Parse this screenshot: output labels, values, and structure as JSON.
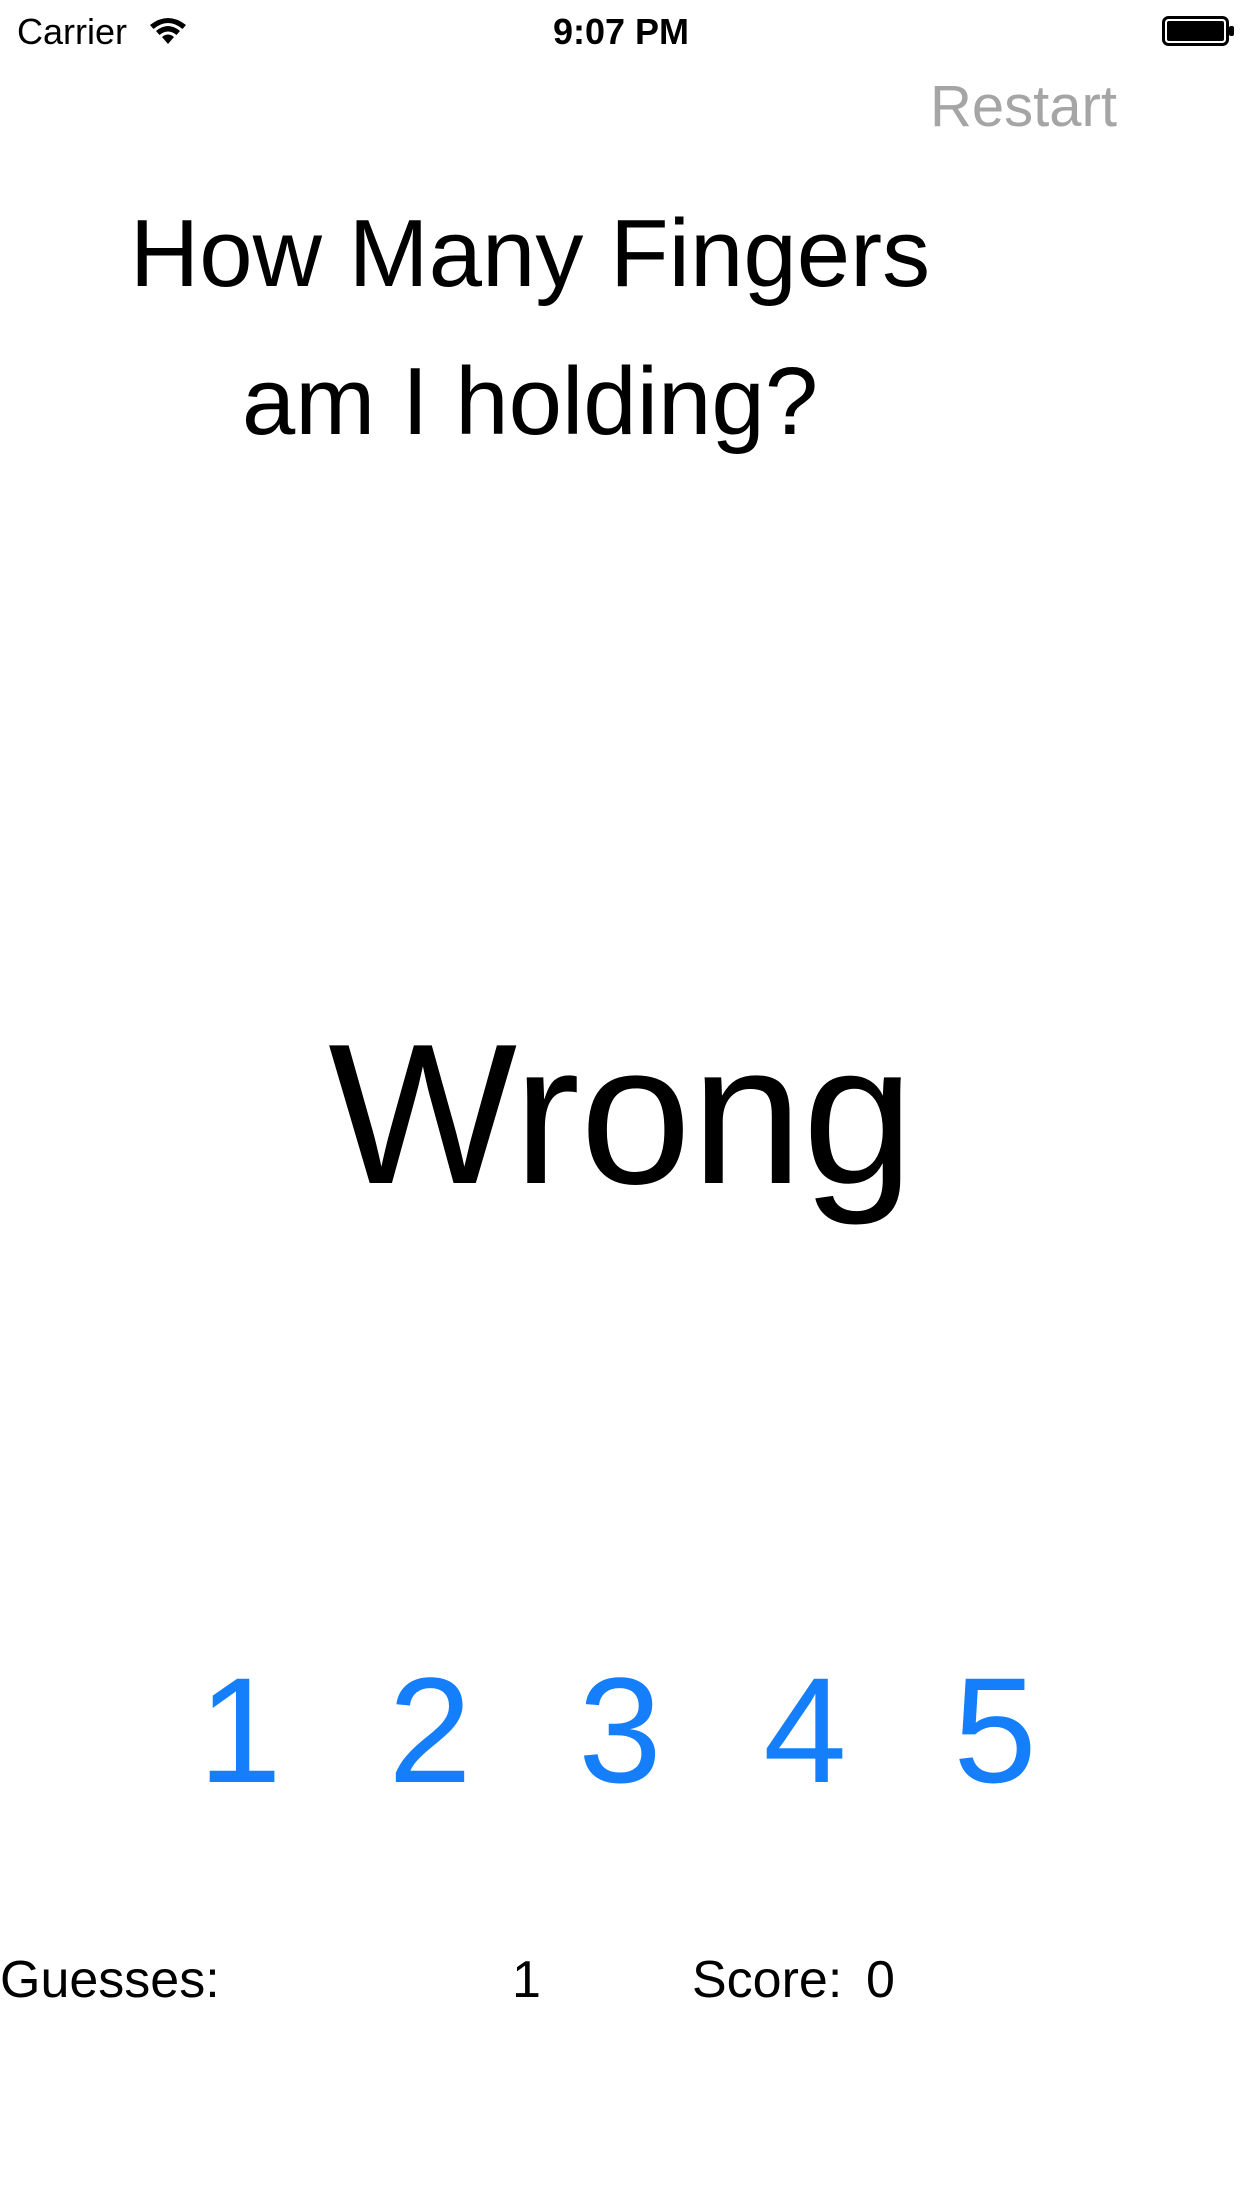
{
  "status_bar": {
    "carrier": "Carrier",
    "time": "9:07 PM",
    "wifi_icon": "wifi-icon",
    "battery_icon": "battery-icon"
  },
  "toolbar": {
    "restart_label": "Restart"
  },
  "question": {
    "line1": "How Many Fingers",
    "line2": "am I holding?"
  },
  "result": "Wrong",
  "choices": [
    "1",
    "2",
    "3",
    "4",
    "5"
  ],
  "stats": {
    "guesses_label": "Guesses:",
    "guesses_value": "1",
    "score_label": "Score:",
    "score_value": "0"
  },
  "colors": {
    "accent": "#157efb",
    "restart": "#a5a5a5",
    "text": "#000000",
    "background": "#ffffff"
  }
}
